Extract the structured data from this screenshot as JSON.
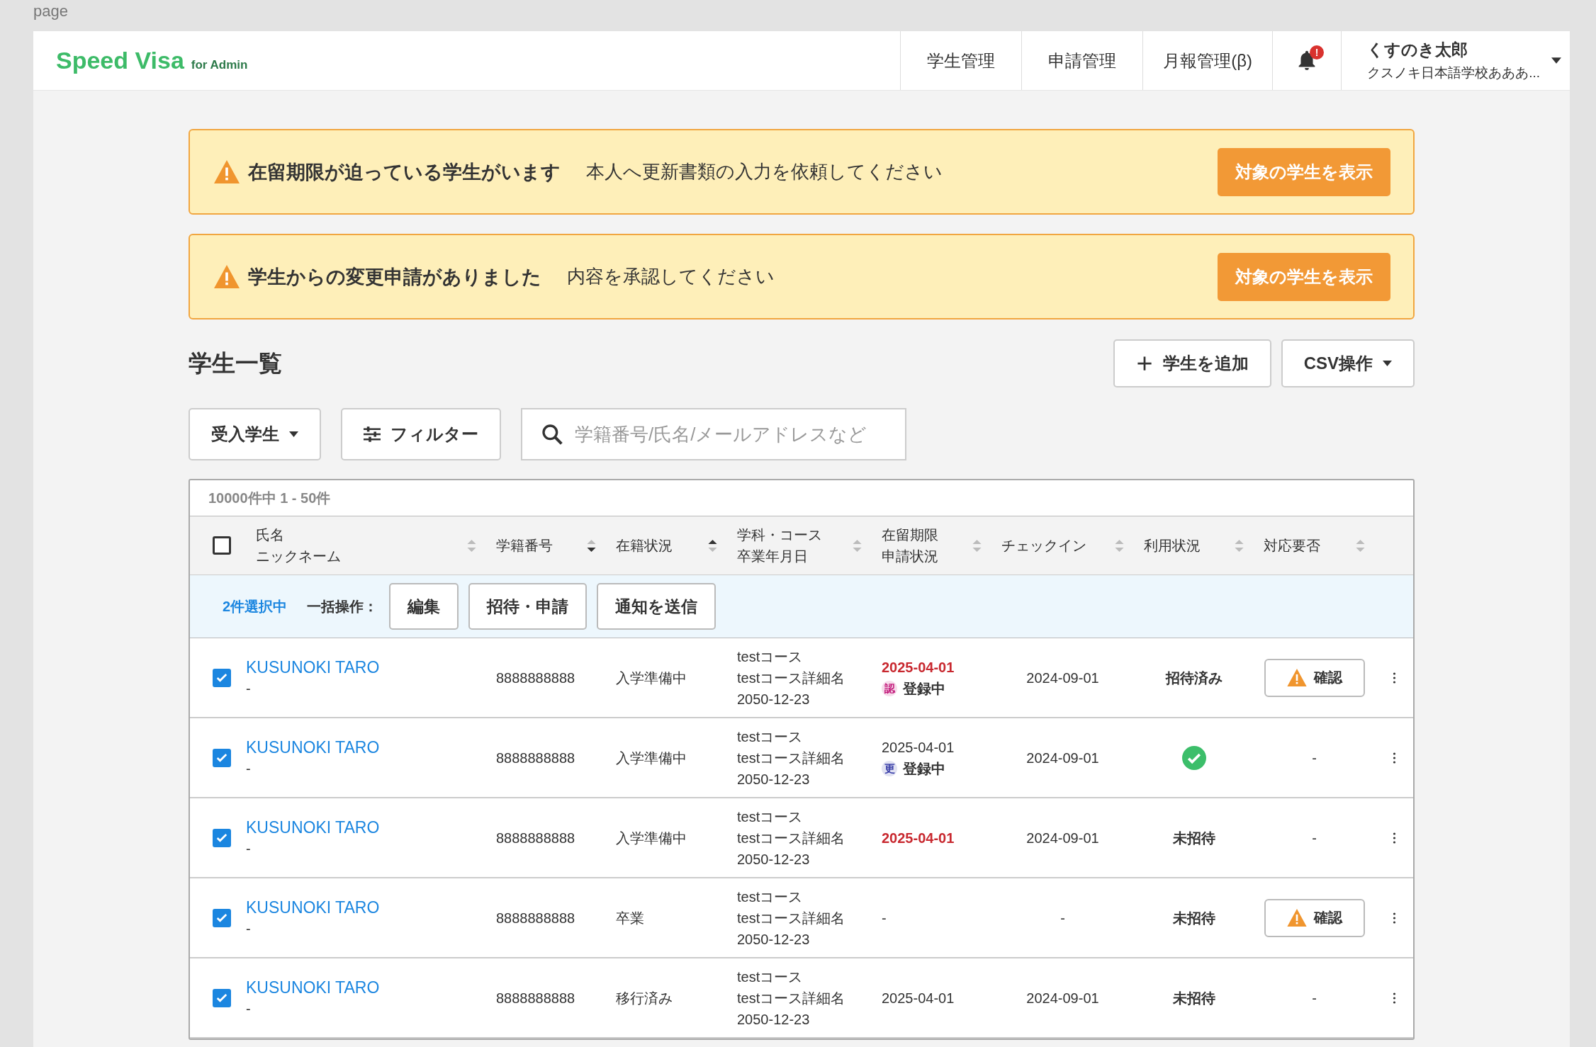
{
  "page_label": "page",
  "header": {
    "logo": "Speed Visa",
    "logo_sub": "for Admin",
    "nav": [
      {
        "label": "学生管理"
      },
      {
        "label": "申請管理"
      },
      {
        "label": "月報管理(β)"
      }
    ],
    "notification_badge": "!",
    "user": {
      "name": "くすのき太郎",
      "school": "クスノキ日本語学校あああ..."
    }
  },
  "alerts": [
    {
      "title": "在留期限が迫っている学生がいます",
      "message": "本人へ更新書類の入力を依頼してください",
      "button": "対象の学生を表示"
    },
    {
      "title": "学生からの変更申請がありました",
      "message": "内容を承認してください",
      "button": "対象の学生を表示"
    }
  ],
  "section": {
    "title": "学生一覧",
    "add_button": "学生を追加",
    "csv_button": "CSV操作"
  },
  "filters": {
    "dropdown": "受入学生",
    "filter": "フィルター",
    "search": {
      "placeholder": "学籍番号/氏名/メールアドレスなど"
    }
  },
  "table": {
    "count": "10000件中 1 - 50件",
    "select_all": {
      "checked": false
    },
    "columns": [
      {
        "lines": [
          "氏名",
          "ニックネーム"
        ],
        "sorted_asc": false,
        "sorted_desc": false
      },
      {
        "lines": [
          "学籍番号"
        ],
        "sorted_asc": false,
        "sorted_desc": true
      },
      {
        "lines": [
          "在籍状況"
        ],
        "sorted_asc": true,
        "sorted_desc": false
      },
      {
        "lines": [
          "学科・コース",
          "卒業年月日"
        ],
        "sorted_asc": false,
        "sorted_desc": false
      },
      {
        "lines": [
          "在留期限",
          "申請状況"
        ],
        "sorted_asc": false,
        "sorted_desc": false
      },
      {
        "lines": [
          "チェックイン"
        ],
        "sorted_asc": false,
        "sorted_desc": false
      },
      {
        "lines": [
          "利用状況"
        ],
        "sorted_asc": false,
        "sorted_desc": false
      },
      {
        "lines": [
          "対応要否"
        ],
        "sorted_asc": false,
        "sorted_desc": false
      }
    ],
    "bulk": {
      "count": "2件選択中",
      "label": "一括操作：",
      "buttons": [
        "編集",
        "招待・申請",
        "通知を送信"
      ]
    },
    "rows": [
      {
        "selected": true,
        "name": "KUSUNOKI TARO",
        "nickname": "-",
        "number": "8888888888",
        "status": "入学準備中",
        "course": [
          "testコース",
          "testコース詳細名",
          "2050-12-23"
        ],
        "expiry": {
          "text": "2025-04-01",
          "urgent": true
        },
        "application": {
          "badge": "認",
          "color": "#c2187a",
          "label": "登録中"
        },
        "checkin": "2024-09-01",
        "usage": {
          "kind": "text",
          "text": "招待済み"
        },
        "action": {
          "kind": "confirm",
          "label": "確認"
        }
      },
      {
        "selected": true,
        "name": "KUSUNOKI TARO",
        "nickname": "-",
        "number": "8888888888",
        "status": "入学準備中",
        "course": [
          "testコース",
          "testコース詳細名",
          "2050-12-23"
        ],
        "expiry": {
          "text": "2025-04-01",
          "urgent": false
        },
        "application": {
          "badge": "更",
          "color": "#3a3fa8",
          "label": "登録中"
        },
        "checkin": "2024-09-01",
        "usage": {
          "kind": "check"
        },
        "action": {
          "kind": "text",
          "text": "-"
        }
      },
      {
        "selected": true,
        "name": "KUSUNOKI TARO",
        "nickname": "-",
        "number": "8888888888",
        "status": "入学準備中",
        "course": [
          "testコース",
          "testコース詳細名",
          "2050-12-23"
        ],
        "expiry": {
          "text": "2025-04-01",
          "urgent": true
        },
        "checkin": "2024-09-01",
        "usage": {
          "kind": "text",
          "text": "未招待"
        },
        "action": {
          "kind": "text",
          "text": "-"
        }
      },
      {
        "selected": true,
        "name": "KUSUNOKI TARO",
        "nickname": "-",
        "number": "8888888888",
        "status": "卒業",
        "course": [
          "testコース",
          "testコース詳細名",
          "2050-12-23"
        ],
        "expiry": {
          "text": "-",
          "urgent": false
        },
        "checkin": "-",
        "usage": {
          "kind": "text",
          "text": "未招待"
        },
        "action": {
          "kind": "confirm",
          "label": "確認"
        }
      },
      {
        "selected": true,
        "name": "KUSUNOKI TARO",
        "nickname": "-",
        "number": "8888888888",
        "status": "移行済み",
        "course": [
          "testコース",
          "testコース詳細名",
          "2050-12-23"
        ],
        "expiry": {
          "text": "2025-04-01",
          "urgent": false
        },
        "checkin": "2024-09-01",
        "usage": {
          "kind": "text",
          "text": "未招待"
        },
        "action": {
          "kind": "text",
          "text": "-"
        }
      }
    ]
  }
}
